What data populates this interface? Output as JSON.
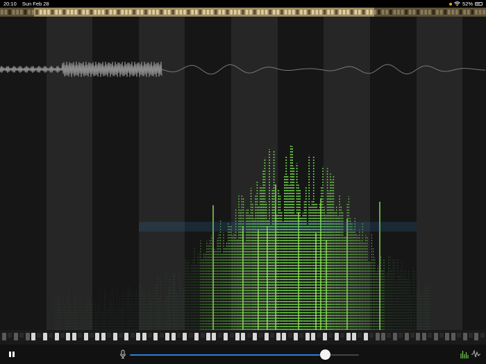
{
  "status": {
    "time": "20:10",
    "date": "Sun Feb 28",
    "battery_text": "52%",
    "battery_level": 0.52,
    "recording_indicator": "orange-dot",
    "wifi_icon": "wifi-icon"
  },
  "overview": {
    "visible_range_start": 0.07,
    "visible_range_end": 0.77
  },
  "controls": {
    "playback_state": "playing",
    "pause_icon": "pause-icon",
    "mic_icon": "microphone-icon",
    "gain_level": 0.85,
    "mode_icons": [
      "spectrogram-icon",
      "waveform-icon"
    ]
  },
  "colors": {
    "spectrum_green": "#6fd24a",
    "spectrum_blue": "#2f7fbf",
    "slider_accent": "#2f7fe0",
    "overview_gold": "#8a7a52"
  }
}
